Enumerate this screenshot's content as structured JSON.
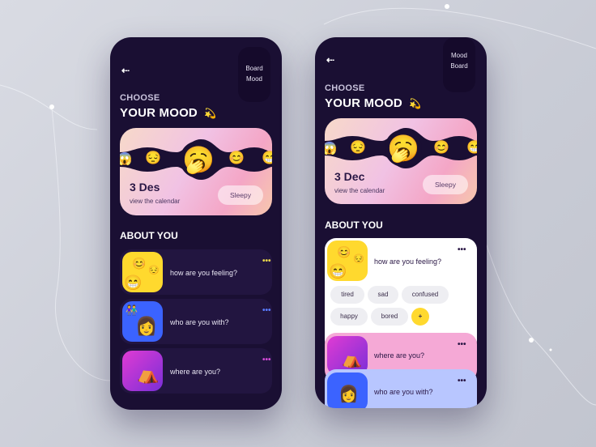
{
  "left_phone": {
    "board_label": "Board\nMood",
    "choose": "CHOOSE",
    "your_mood": "YOUR MOOD",
    "mood_emoji": "💫",
    "emojis": [
      "😱",
      "😔",
      "🥱",
      "😊",
      "😁"
    ],
    "date": "3 Des",
    "view_calendar": "view the calendar",
    "mood_pill": "Sleepy",
    "about_title": "ABOUT YOU",
    "rows": [
      {
        "label": "how are you feeling?",
        "dots": "•••",
        "dots_color": "#e8d64a"
      },
      {
        "label": "who are you with?",
        "dots": "•••",
        "dots_color": "#5a7cff"
      },
      {
        "label": "where are you?",
        "dots": "•••",
        "dots_color": "#d44ad8"
      }
    ]
  },
  "right_phone": {
    "board_label": "Mood\nBoard",
    "choose": "CHOOSE",
    "your_mood": "YOUR MOOD",
    "mood_emoji": "💫",
    "emojis": [
      "😱",
      "😔",
      "🥱",
      "😊",
      "😁"
    ],
    "date": "3 Dec",
    "view_calendar": "view the calendar",
    "mood_pill": "Sleepy",
    "about_title": "ABOUT YOU",
    "feeling_label": "how are you feeling?",
    "feeling_dots": "•••",
    "tags": [
      "tired",
      "sad",
      "confused",
      "happy",
      "bored"
    ],
    "add_label": "+",
    "where_label": "where are you?",
    "where_dots": "•••",
    "with_label": "who are you with?",
    "with_dots": "•••"
  },
  "colors": {
    "phone_bg": "#1a0f33",
    "accent_yellow": "#ffd92e",
    "accent_pink": "#f5a9d6",
    "accent_blue": "#b8c6ff"
  },
  "icons": {
    "back": "back-arrow-icon"
  }
}
